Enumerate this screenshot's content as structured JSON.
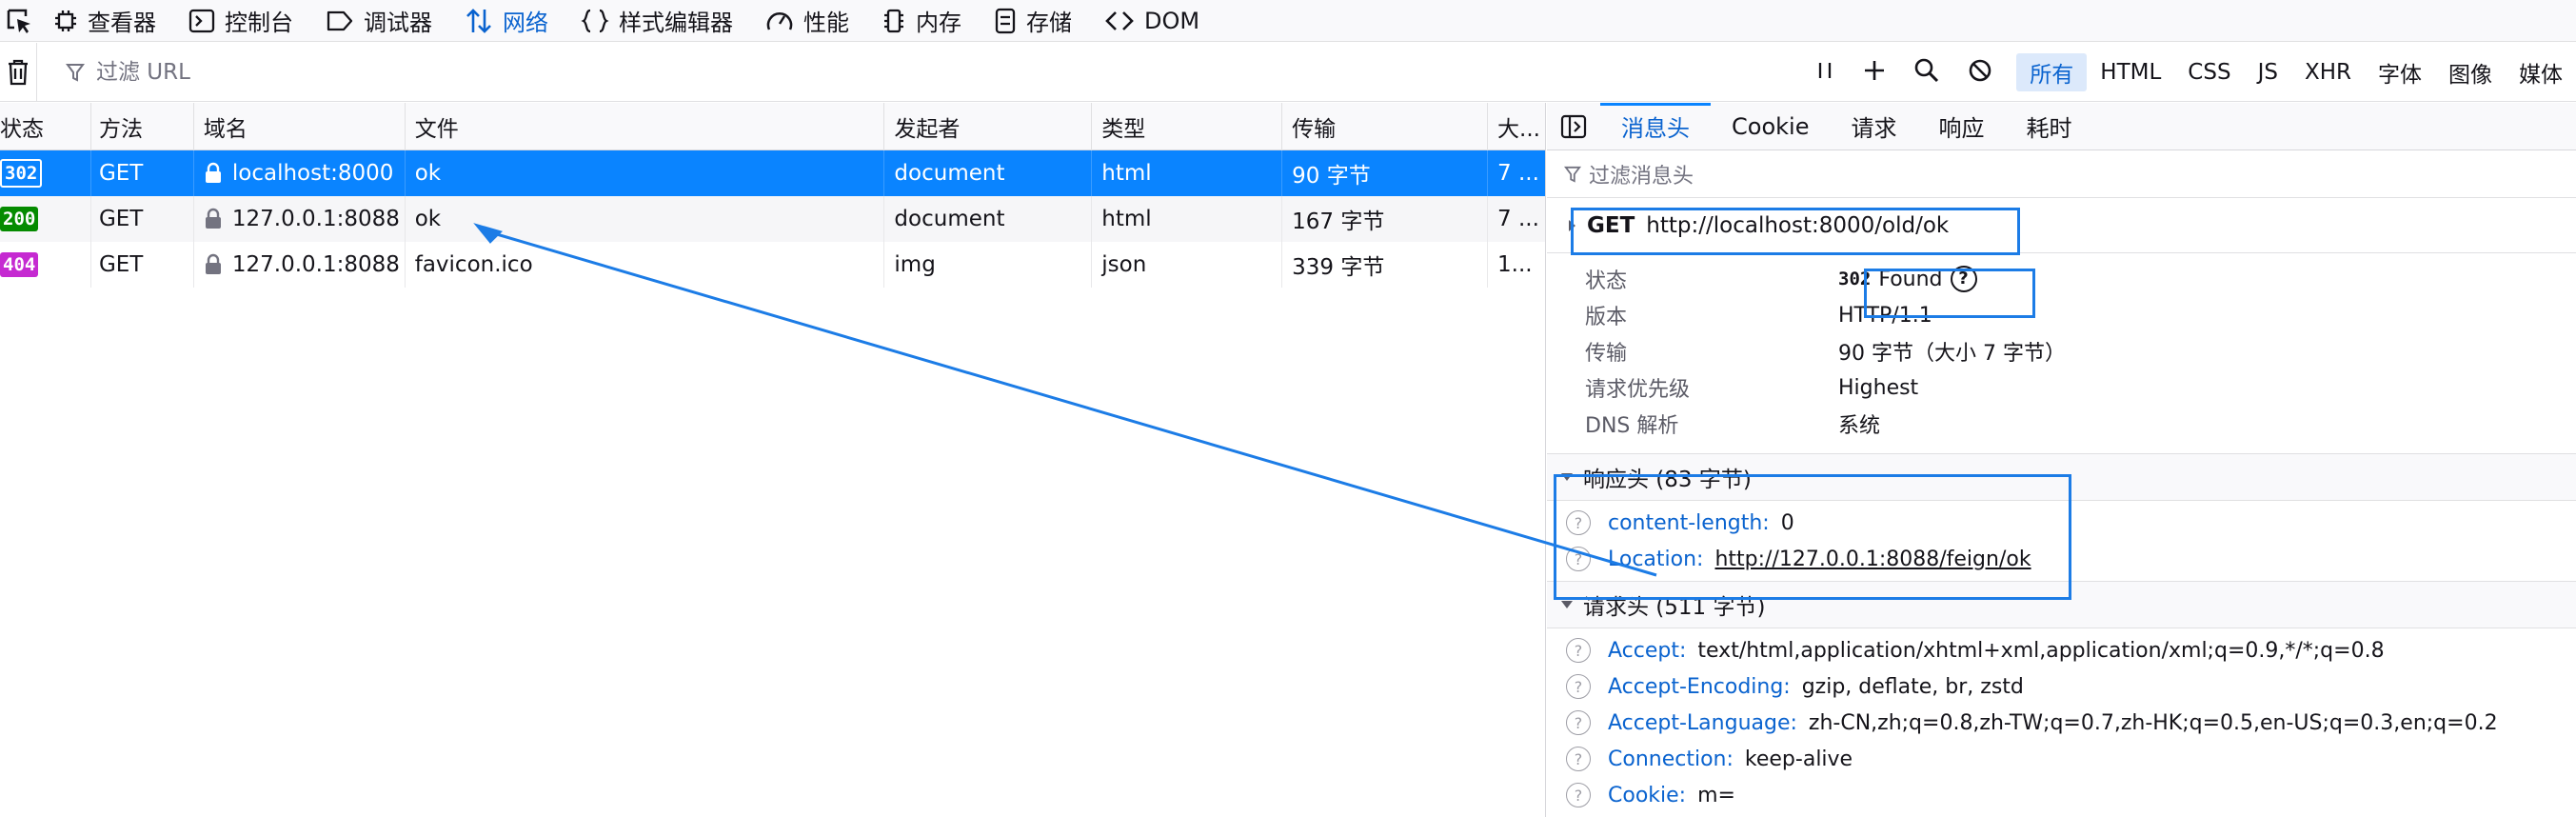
{
  "toolbox": {
    "tabs": [
      {
        "label": "查看器",
        "icon": "inspector-icon"
      },
      {
        "label": "控制台",
        "icon": "console-icon"
      },
      {
        "label": "调试器",
        "icon": "debugger-icon"
      },
      {
        "label": "网络",
        "icon": "network-icon",
        "active": true
      },
      {
        "label": "样式编辑器",
        "icon": "style-editor-icon"
      },
      {
        "label": "性能",
        "icon": "performance-icon"
      },
      {
        "label": "内存",
        "icon": "memory-icon"
      },
      {
        "label": "存储",
        "icon": "storage-icon"
      },
      {
        "label": "DOM",
        "icon": "dom-icon"
      }
    ]
  },
  "filterbar": {
    "placeholder": "过滤 URL",
    "types": [
      "所有",
      "HTML",
      "CSS",
      "JS",
      "XHR",
      "字体",
      "图像",
      "媒体"
    ]
  },
  "columns": {
    "status": "状态",
    "method": "方法",
    "domain": "域名",
    "file": "文件",
    "initiator": "发起者",
    "type": "类型",
    "transferred": "传输",
    "size": "大..."
  },
  "requests": [
    {
      "status": "302",
      "method": "GET",
      "domain": "localhost:8000",
      "file": "ok",
      "initiator": "document",
      "type": "html",
      "transferred": "90 字节",
      "size": "7 ..."
    },
    {
      "status": "200",
      "method": "GET",
      "domain": "127.0.0.1:8088",
      "file": "ok",
      "initiator": "document",
      "type": "html",
      "transferred": "167 字节",
      "size": "7 ..."
    },
    {
      "status": "404",
      "method": "GET",
      "domain": "127.0.0.1:8088",
      "file": "favicon.ico",
      "initiator": "img",
      "type": "json",
      "transferred": "339 字节",
      "size": "1..."
    }
  ],
  "details": {
    "tabs": [
      "消息头",
      "Cookie",
      "请求",
      "响应",
      "耗时"
    ],
    "filter_placeholder": "过滤消息头",
    "summary": {
      "method": "GET",
      "url": "http://localhost:8000/old/ok"
    },
    "info": {
      "status_label": "状态",
      "status_code": "302",
      "status_text": "Found",
      "version_label": "版本",
      "version": "HTTP/1.1",
      "transfer_label": "传输",
      "transfer": "90 字节（大小 7 字节）",
      "priority_label": "请求优先级",
      "priority": "Highest",
      "dns_label": "DNS 解析",
      "dns": "系统"
    },
    "response_headers": {
      "title": "响应头 (83 字节)",
      "items": [
        {
          "name": "content-length:",
          "value": "0"
        },
        {
          "name": "Location:",
          "value": "http://127.0.0.1:8088/feign/ok"
        }
      ]
    },
    "request_headers": {
      "title": "请求头 (511 字节)",
      "items": [
        {
          "name": "Accept:",
          "value": "text/html,application/xhtml+xml,application/xml;q=0.9,*/*;q=0.8"
        },
        {
          "name": "Accept-Encoding:",
          "value": "gzip, deflate, br, zstd"
        },
        {
          "name": "Accept-Language:",
          "value": "zh-CN,zh;q=0.8,zh-TW;q=0.7,zh-HK;q=0.5,en-US;q=0.3,en;q=0.2"
        },
        {
          "name": "Connection:",
          "value": "keep-alive"
        },
        {
          "name": "Cookie:",
          "value": "m="
        }
      ]
    }
  },
  "colors": {
    "accent": "#0a84ff",
    "annotation": "#1c7ce6",
    "status_200": "#058b00",
    "status_404": "#c52ad1"
  }
}
